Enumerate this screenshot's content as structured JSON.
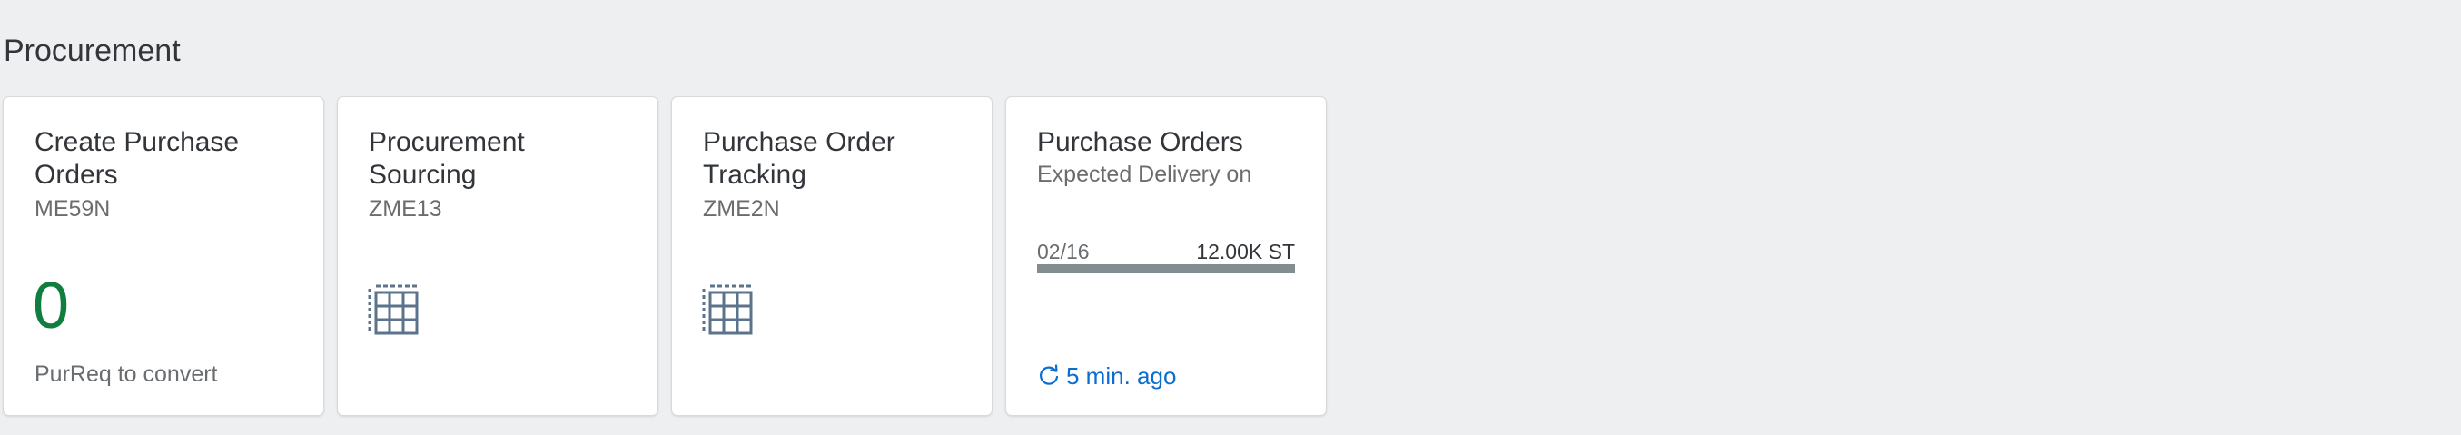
{
  "group": {
    "title": "Procurement"
  },
  "tiles": [
    {
      "title": "Create Purchase Orders",
      "subtitle": "ME59N",
      "kpi": "0",
      "footer": "PurReq to convert"
    },
    {
      "title": "Procurement Sourcing",
      "subtitle": "ZME13",
      "icon": "table-grid-icon"
    },
    {
      "title": "Purchase Order Tracking",
      "subtitle": "ZME2N",
      "icon": "table-grid-icon"
    },
    {
      "title": "Purchase Orders",
      "subtitle": "Expected Delivery on",
      "bar": {
        "date": "02/16",
        "value": "12.00K ST",
        "fill_fraction": 1.0
      },
      "refresh_icon": "refresh-icon",
      "refresh_text": "5 min. ago"
    }
  ],
  "colors": {
    "background": "#edeff0",
    "kpi_green": "#107e3e",
    "link_blue": "#0a6ed1",
    "icon_blue": "#5b738b",
    "bar_gray": "#838c91"
  }
}
